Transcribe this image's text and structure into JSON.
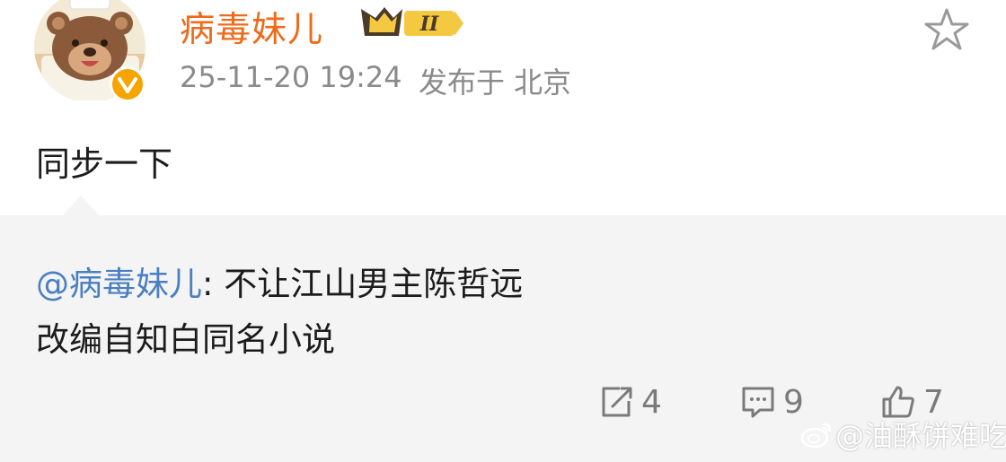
{
  "post": {
    "author": "病毒妹儿",
    "timestamp": "25-11-20 19:24",
    "location": "发布于 北京",
    "text": "同步一下",
    "badge_level": "II"
  },
  "repost": {
    "mention": "@病毒妹儿",
    "colon": ":",
    "text_line1": "不让江山男主陈哲远",
    "text_line2": "改编自知白同名小说"
  },
  "actions": {
    "reposts": "4",
    "comments": "9",
    "likes": "7"
  },
  "watermark": {
    "text": "@油酥饼难吃"
  },
  "colors": {
    "username": "#ef6a1a",
    "mention": "#4a7fc2",
    "meta": "#8a8a8a",
    "repost_bg": "#f4f4f4",
    "badge": "#f5a400"
  }
}
